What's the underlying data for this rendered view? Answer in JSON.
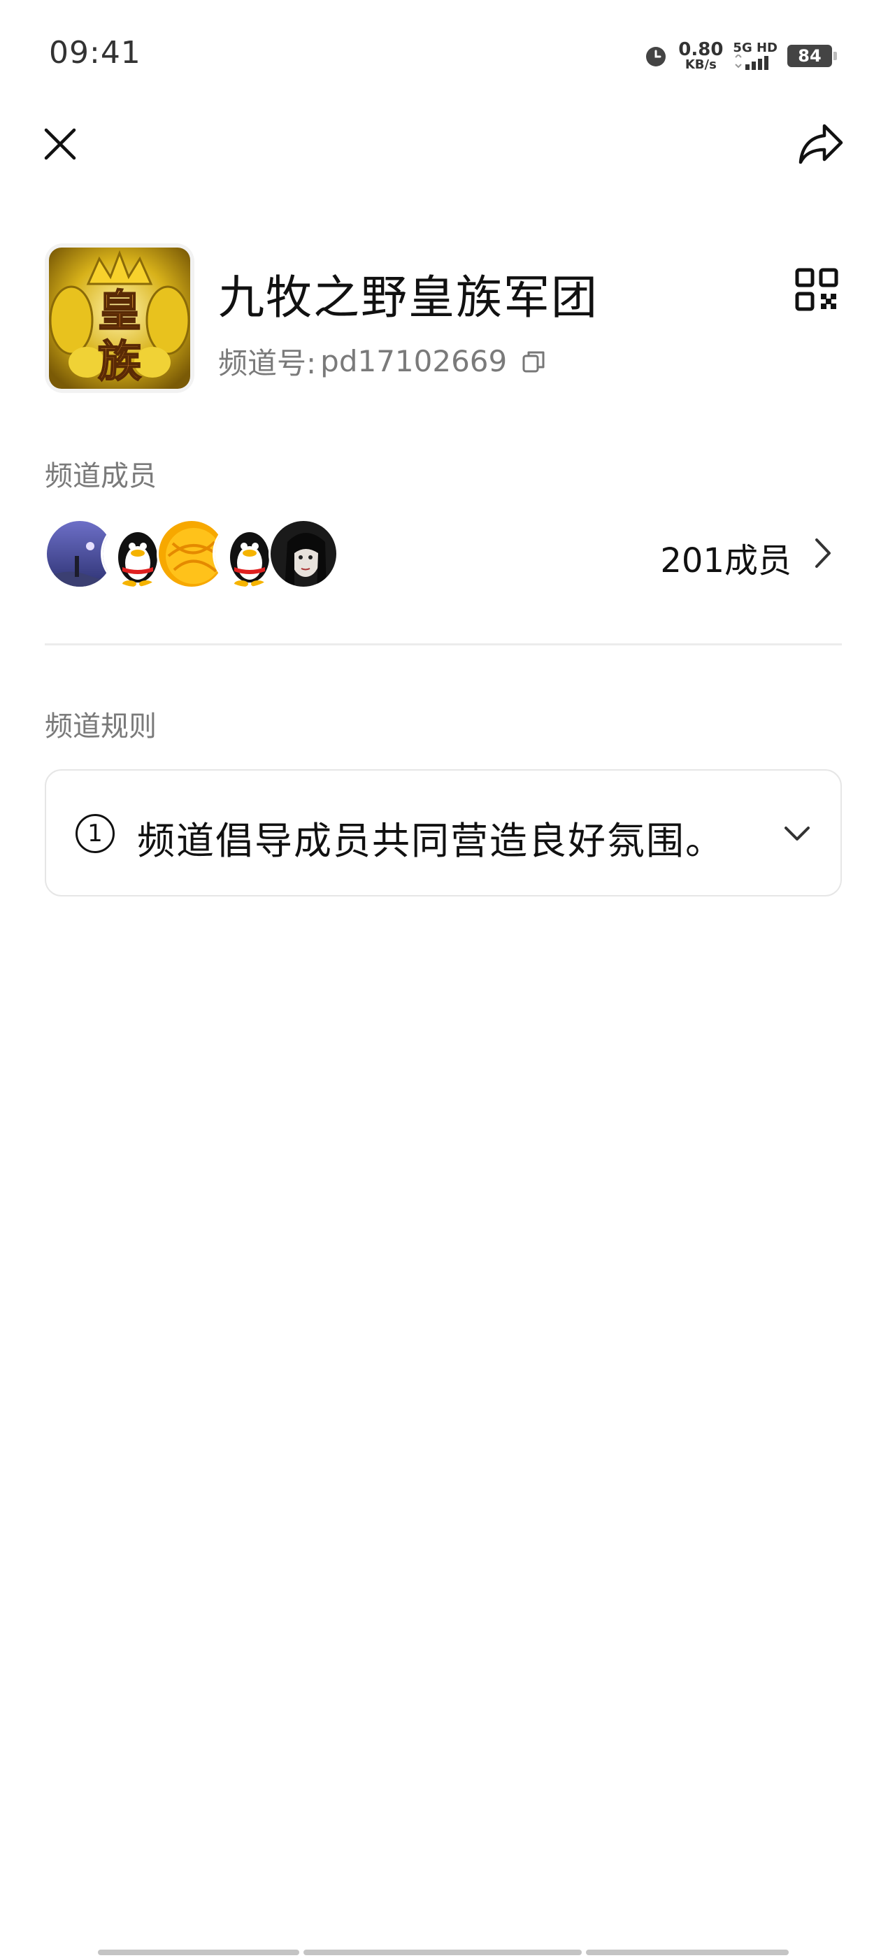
{
  "status_bar": {
    "time": "09:41",
    "net_speed_value": "0.80",
    "net_speed_unit": "KB/s",
    "network_label": "5G HD",
    "battery": "84"
  },
  "header": {
    "close_icon": "close-icon",
    "share_icon": "share-icon"
  },
  "channel": {
    "name": "九牧之野皇族军团",
    "id_prefix": "频道号:",
    "id_value": "pd17102669",
    "avatar_text": "皇族",
    "qr_icon": "qr-code-icon",
    "copy_icon": "copy-icon"
  },
  "members": {
    "label": "频道成员",
    "count_text": "201成员",
    "avatars": [
      "avatar-landscape",
      "avatar-penguin",
      "avatar-orange",
      "avatar-penguin",
      "avatar-dark"
    ]
  },
  "rules": {
    "label": "频道规则",
    "items": [
      {
        "number": "1",
        "text": "频道倡导成员共同营造良好氛围。"
      }
    ]
  },
  "colors": {
    "text_primary": "#111111",
    "text_secondary": "#7a7a7a",
    "divider": "#ececec",
    "card_border": "#e6e6e6"
  }
}
